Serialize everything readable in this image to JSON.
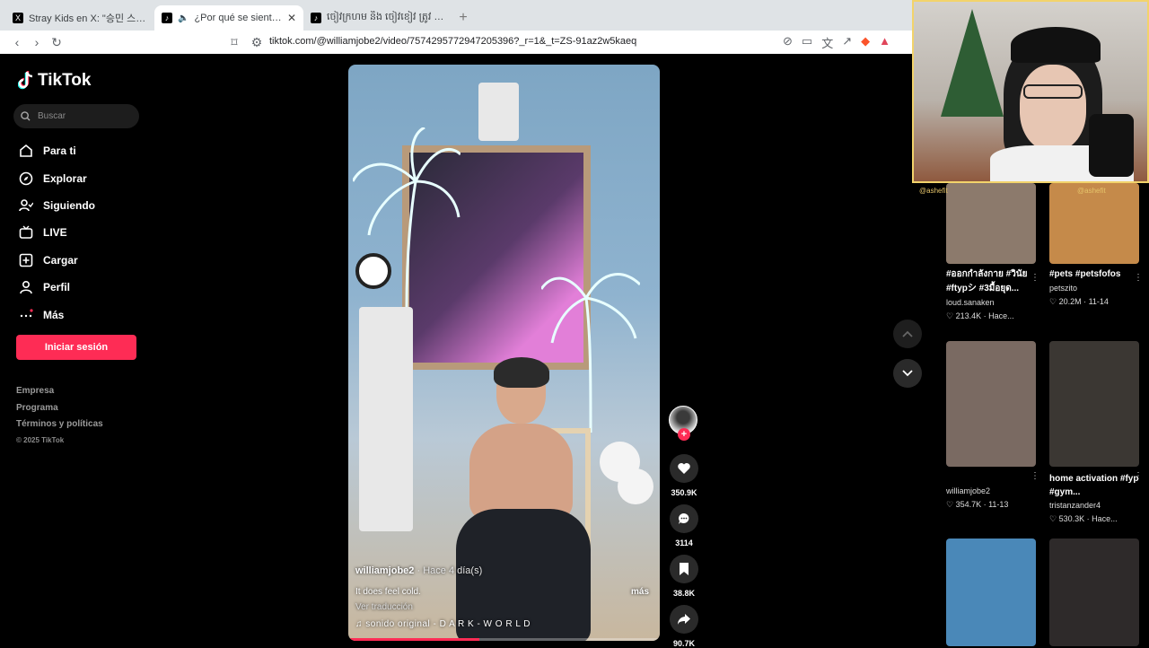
{
  "browser": {
    "tabs": [
      {
        "title": "Stray Kids en X: \"승민 스케줄 관련 안",
        "icon": "X"
      },
      {
        "title": "¿Por qué se siente frío? Explo",
        "icon": "♪",
        "active": true
      },
      {
        "title": "ចៀវក្រហម និង ចៀវខៀវ ត្រូវ លក្ខខណ្ឌ",
        "icon": "♪"
      }
    ],
    "url": "tiktok.com/@williamjobe2/video/7574295772947205396?_r=1&_t=ZS-91az2w5kaeq"
  },
  "sidebar": {
    "brand": "TikTok",
    "search_placeholder": "Buscar",
    "nav": [
      {
        "label": "Para ti",
        "icon": "home-icon"
      },
      {
        "label": "Explorar",
        "icon": "compass-icon"
      },
      {
        "label": "Siguiendo",
        "icon": "following-icon"
      },
      {
        "label": "LIVE",
        "icon": "live-icon"
      },
      {
        "label": "Cargar",
        "icon": "upload-icon"
      },
      {
        "label": "Perfil",
        "icon": "profile-icon"
      },
      {
        "label": "Más",
        "icon": "more-icon"
      }
    ],
    "login_label": "Iniciar sesión",
    "footer": [
      "Empresa",
      "Programa",
      "Términos y políticas"
    ],
    "copyright": "© 2025 TikTok"
  },
  "video": {
    "author": "williamjobe2",
    "time": "· Hace 4 día(s)",
    "caption": "It does feel cold.",
    "translate": "Ver traducción",
    "more": "más",
    "sound": "♫  sonido original - D A R K - W O R L D",
    "progress_pct": 42
  },
  "actions": {
    "likes": "350.9K",
    "comments": "3114",
    "saves": "38.8K",
    "shares": "90.7K"
  },
  "grid": [
    {
      "title": "#ออกกำลังกาย #วินัย #ftypシ #3มื้อยุด...",
      "user": "loud.sanaken",
      "stats": "♡ 213.4K · Hace...",
      "color": "#8c7a6c"
    },
    {
      "title": "#pets #petsfofos",
      "user": "petszito",
      "stats": "♡ 20.2M · 11-14",
      "color": "#c58a4a"
    },
    {
      "title": "",
      "user": "williamjobe2",
      "stats": "♡ 354.7K · 11-13",
      "color": "#7a6a62"
    },
    {
      "title": "home activation #fyp #gym...",
      "user": "tristanzander4",
      "stats": "♡ 530.3K · Hace...",
      "color": "#3b3733"
    },
    {
      "title": "",
      "user": "",
      "stats": "",
      "color": "#4a88b8"
    },
    {
      "title": "",
      "user": "",
      "stats": "",
      "color": "#2e2a2a"
    }
  ],
  "cam": {
    "label_left": "@ashefit",
    "label_right": "@ashefit"
  }
}
